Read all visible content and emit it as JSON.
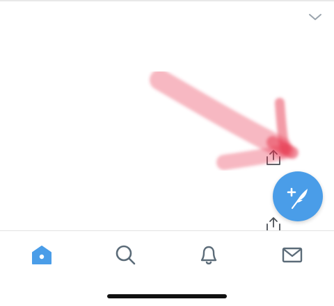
{
  "feed": {
    "collapse_icon": "chevron-down-icon",
    "share_icon": "share-icon"
  },
  "compose": {
    "icon": "compose-feather-icon",
    "color": "#4a9de8"
  },
  "annotation": {
    "color": "#e8374f",
    "description_hidden": ""
  },
  "tab_bar": {
    "accent": "#4a9de8",
    "inactive": "#5b6b78",
    "items": [
      {
        "icon": "home-icon",
        "active": true
      },
      {
        "icon": "search-icon",
        "active": false
      },
      {
        "icon": "bell-icon",
        "active": false
      },
      {
        "icon": "mail-icon",
        "active": false
      }
    ]
  }
}
